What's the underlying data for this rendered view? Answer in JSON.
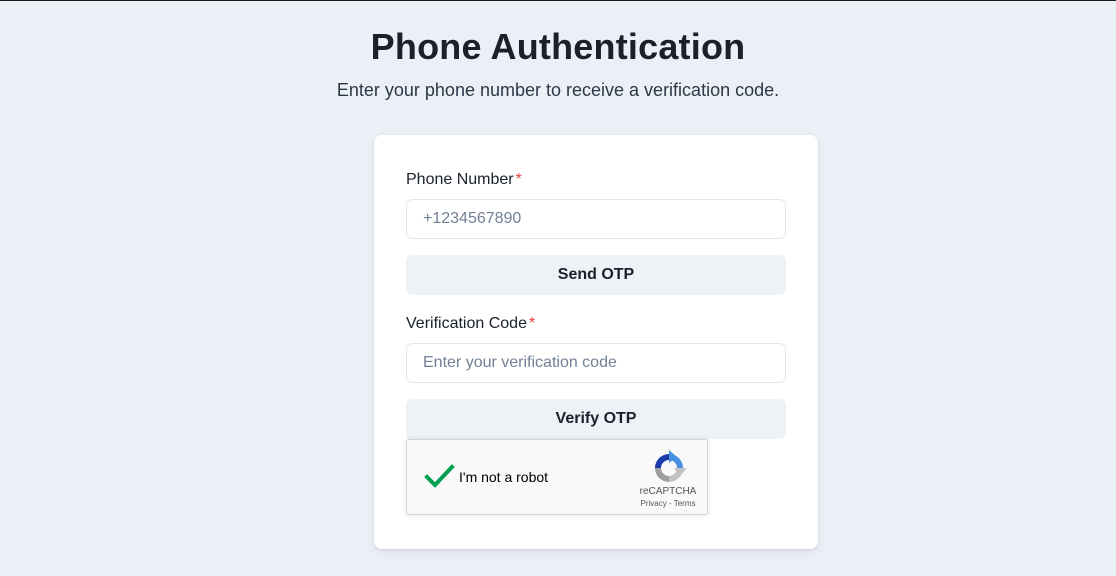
{
  "header": {
    "title": "Phone Authentication",
    "subtitle": "Enter your phone number to receive a verification code."
  },
  "form": {
    "phone": {
      "label": "Phone Number",
      "required_mark": "*",
      "placeholder": "+1234567890",
      "value": ""
    },
    "send_otp_label": "Send OTP",
    "code": {
      "label": "Verification Code",
      "required_mark": "*",
      "placeholder": "Enter your verification code",
      "value": ""
    },
    "verify_otp_label": "Verify OTP"
  },
  "recaptcha": {
    "label": "I'm not a robot",
    "checked": true,
    "brand": "reCAPTCHA",
    "privacy_label": "Privacy",
    "separator": " - ",
    "terms_label": "Terms",
    "check_icon": "checkmark-icon",
    "logo_icon": "recaptcha-logo-icon"
  },
  "colors": {
    "background": "#ebeff6",
    "card": "#ffffff",
    "button": "#edf2f7",
    "required": "#e53e3e",
    "check": "#00a050"
  }
}
